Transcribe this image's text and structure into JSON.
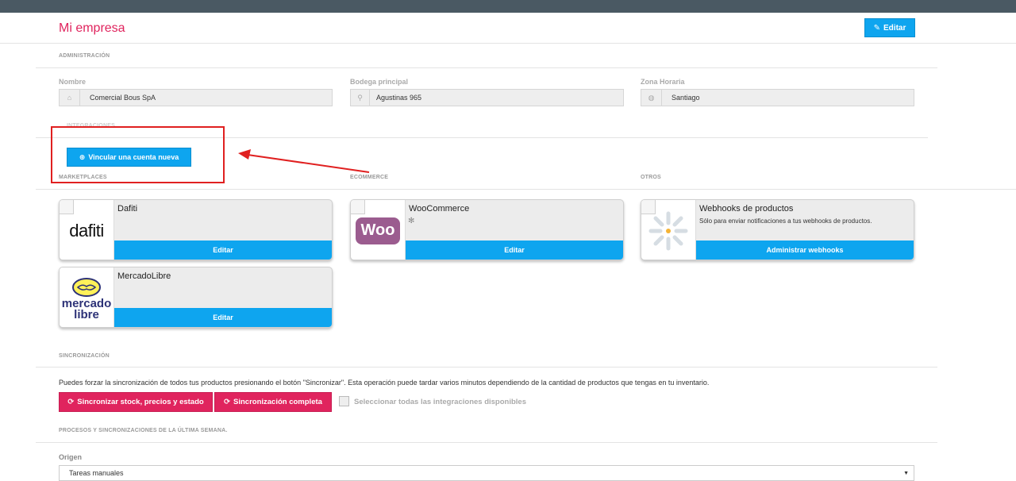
{
  "header": {
    "title": "Mi empresa",
    "edit_label": "Editar",
    "edit_icon": "pencil-icon"
  },
  "admin": {
    "section_title": "ADMINISTRACIÓN",
    "fields": [
      {
        "label": "Nombre",
        "value": "Comercial Bous SpA",
        "icon": "home-icon"
      },
      {
        "label": "Bodega principal",
        "value": "Agustinas 965",
        "icon": "location-pin-icon"
      },
      {
        "label": "Zona Horaria",
        "value": "Santiago",
        "icon": "globe-icon"
      }
    ]
  },
  "integrations": {
    "section_title": "INTEGRACIONES",
    "link_button": "Vincular una cuenta nueva",
    "groups": {
      "marketplaces": "MARKETPLACES",
      "ecommerce": "ECOMMERCE",
      "otros": "OTROS"
    },
    "cards": {
      "dafiti": {
        "name": "Dafiti",
        "logo_text": "dafiti",
        "action": "Editar"
      },
      "woocommerce": {
        "name": "WooCommerce",
        "logo_text": "Woo",
        "action": "Editar"
      },
      "webhooks": {
        "name": "Webhooks de productos",
        "desc": "Sólo para enviar notificaciones a tus webhooks de productos.",
        "action": "Administrar webhooks"
      },
      "mercadolibre": {
        "name": "MercadoLibre",
        "logo_line1": "mercado",
        "logo_line2": "libre",
        "action": "Editar"
      }
    }
  },
  "sync": {
    "section_title": "SINCRONIZACIÓN",
    "description": "Puedes forzar la sincronización de todos tus productos presionando el botón \"Sincronizar\". Esta operación puede tardar varios minutos dependiendo de la cantidad de productos que tengas en tu inventario.",
    "btn_stock": "Sincronizar stock, precios y estado",
    "btn_full": "Sincronización completa",
    "select_all_label": "Seleccionar todas las integraciones disponibles"
  },
  "processes": {
    "section_title": "PROCESOS Y SINCRONIZACIONES DE LA ÚLTIMA SEMANA.",
    "origin_label": "Origen",
    "origin_value": "Tareas manuales"
  },
  "colors": {
    "accent_blue": "#0ea5ef",
    "accent_pink": "#e0245e",
    "annotation_red": "#e02020"
  }
}
